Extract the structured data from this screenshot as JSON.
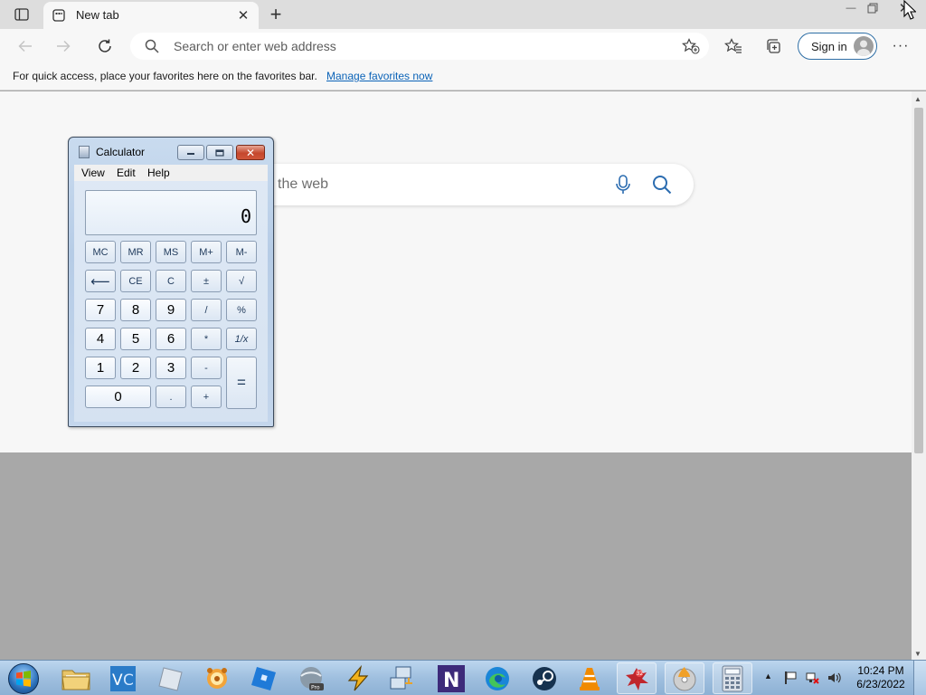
{
  "browser": {
    "tab": {
      "title": "New tab"
    },
    "address_bar": {
      "placeholder": "Search or enter web address",
      "value": ""
    },
    "sign_in_label": "Sign in",
    "favorites_bar": {
      "message": "For quick access, place your favorites here on the favorites bar.",
      "link": "Manage favorites now"
    },
    "page": {
      "search_placeholder": "the web"
    }
  },
  "calculator": {
    "title": "Calculator",
    "menu": [
      "View",
      "Edit",
      "Help"
    ],
    "display": "0",
    "buttons": {
      "mc": "MC",
      "mr": "MR",
      "ms": "MS",
      "mplus": "M+",
      "mminus": "M-",
      "back": "⟵",
      "ce": "CE",
      "c": "C",
      "plusminus": "±",
      "sqrt": "√",
      "n7": "7",
      "n8": "8",
      "n9": "9",
      "div": "/",
      "pct": "%",
      "n4": "4",
      "n5": "5",
      "n6": "6",
      "mul": "*",
      "recip": "1/x",
      "n1": "1",
      "n2": "2",
      "n3": "3",
      "sub": "-",
      "n0": "0",
      "dot": ".",
      "add": "+",
      "eq": "="
    }
  },
  "taskbar": {
    "apps": [
      "Windows Explorer",
      "VC",
      "Roblox Studio",
      "GIMP",
      "Roblox",
      "Google Earth Pro",
      "Winamp",
      "Network Scanner",
      "N",
      "Microsoft Edge",
      "Steam",
      "VLC media player",
      "Ant",
      "Burning",
      "Calculator"
    ],
    "clock": {
      "time": "10:24 PM",
      "date": "6/23/2022"
    }
  },
  "colors": {
    "accent": "#0b63b8",
    "taskbar": "#9fbfdf",
    "calc_frame": "#b6cce6",
    "close_red": "#c5472d"
  }
}
